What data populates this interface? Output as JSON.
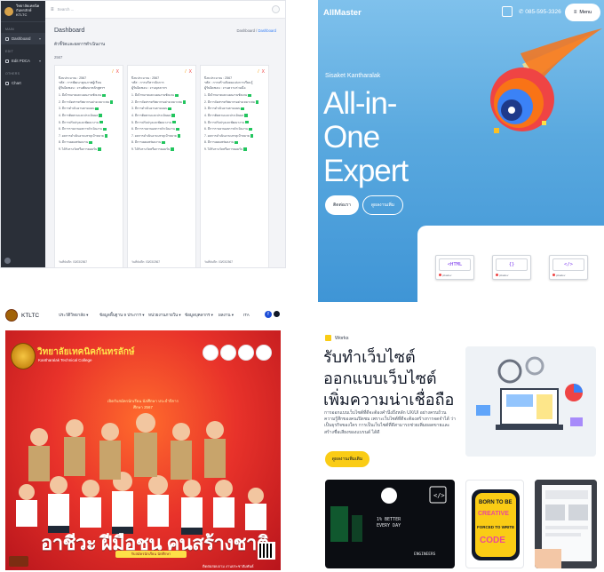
{
  "dashboard": {
    "brand_line1": "วิทยาลัยเทคนิคกันทรลักษ์",
    "brand_line2": "KTLTC",
    "search_placeholder": "Search ...",
    "nav_section_main": "MAIN",
    "nav_dashboard": "Dashboard",
    "nav_section_edit": "EDIT",
    "nav_edit_pdca": "Edit PDCA",
    "nav_section_other": "OTHERS",
    "nav_chart": "Chart",
    "page_title": "Dashboard",
    "breadcrumb_root": "Dashboard",
    "breadcrumb_sep": " / ",
    "breadcrumb_current": "Dashboard",
    "subtitle": "ตัวชี้วัดและผลการดำเนินงาน",
    "year": "2567",
    "cards": [
      {
        "meta_year": "ปีงบประมาณ : 2567",
        "meta_code": "รหัส : การพัฒนาคุณภาพผู้เรียน",
        "meta_owner": "ผู้รับผิดชอบ : งานพัฒนาหลักสูตรฯ",
        "items": [
          "1. มีเป้าหมายและแผนงานชัดเจน",
          "2. มีการจัดสรรทรัพยากรอย่างเหมาะสม",
          "3. มีการดำเนินงานตามแผน",
          "4. มีการติดตามและประเมินผล",
          "5. มีการปรับปรุงและพัฒนางาน",
          "6. มีการรายงานผลการดำเนินงาน",
          "7. ผลการดำเนินงานบรรลุเป้าหมาย",
          "8. มีการเผยแพร่ผลงาน",
          "9. ได้รับรางวัลหรือการยอมรับ"
        ],
        "footer": "วันที่บันทึก: 03/03/2567"
      },
      {
        "meta_year": "ปีงบประมาณ : 2567",
        "meta_code": "รหัส : การบริหารจัดการ",
        "meta_owner": "ผู้รับผิดชอบ : งานบุคลากร",
        "items": [
          "1. มีเป้าหมายและแผนงานชัดเจน",
          "2. มีการจัดสรรทรัพยากรอย่างเหมาะสม",
          "3. มีการดำเนินงานตามแผน",
          "4. มีการติดตามและประเมินผล",
          "5. มีการปรับปรุงและพัฒนางาน",
          "6. มีการรายงานผลการดำเนินงาน",
          "7. ผลการดำเนินงานบรรลุเป้าหมาย",
          "8. มีการเผยแพร่ผลงาน",
          "9. ได้รับรางวัลหรือการยอมรับ"
        ],
        "footer": "วันที่บันทึก: 03/03/2567"
      },
      {
        "meta_year": "ปีงบประมาณ : 2567",
        "meta_code": "รหัส : การสร้างสังคมแห่งการเรียนรู้",
        "meta_owner": "ผู้รับผิดชอบ : งานความร่วมมือ",
        "items": [
          "1. มีเป้าหมายและแผนงานชัดเจน",
          "2. มีการจัดสรรทรัพยากรอย่างเหมาะสม",
          "3. มีการดำเนินงานตามแผน",
          "4. มีการติดตามและประเมินผล",
          "5. มีการปรับปรุงและพัฒนางาน",
          "6. มีการรายงานผลการดำเนินงาน",
          "7. ผลการดำเนินงานบรรลุเป้าหมาย",
          "8. มีการเผยแพร่ผลงาน",
          "9. ได้รับรางวัลหรือการยอมรับ"
        ],
        "footer": "วันที่บันทึก: 03/03/2567"
      }
    ],
    "edit_icon_glyph": "/",
    "delete_icon_glyph": "X"
  },
  "allmaster": {
    "logo": "AllMaster",
    "phone": "085-595-3326",
    "menu_label": "Menu",
    "school": "Sisaket Kantharalak",
    "headline_1": "All-in-",
    "headline_2": "One",
    "headline_3": "Expert",
    "btn_primary": "ติดต่อเรา",
    "btn_secondary": "ดูผลงานเพิ่ม",
    "chips": [
      {
        "code": "<HTML",
        "caption": "pikadev"
      },
      {
        "code": "{}",
        "caption": "pikadev"
      },
      {
        "code": "</>",
        "caption": "pikadev"
      }
    ],
    "works_label": "Works",
    "works_title": "รับทำเว็บไซต์ ออกแบบเว็บไซต์ เพิ่มความน่าเชื่อถือ",
    "works_desc": "การออกแบบเว็บไซต์ที่ดีจะต้องคำนึงถึงหลัก UX/UI อย่างครบถ้วน ความรู้สึกของคนเปิดชม เพราะเว็บไซต์ที่ดีจะต้องสร้างการจดจำได้ ว่าเป็นธุรกิจของใคร การเป็นเว็บไซต์ที่ดีสามารถช่วยเพิ่มยอดขายและสร้างชื่อเสียงของแบรนด์ ได้ดี",
    "works_btn": "ดูผลงานเพิ่มเติม",
    "g1_text1": "1% BETTER",
    "g1_text2": "EVERY DAY",
    "g1_text3": "ENGINEERS",
    "g2_text1": "BORN TO BE",
    "g2_text2": "CREATIVE",
    "g2_text3": "FORCED TO WRITE",
    "g2_text4": "CODE",
    "colors": {
      "hero_top": "#7fc1ec",
      "accent_yellow": "#facc15"
    }
  },
  "ktltc": {
    "brand": "KTLTC",
    "menu": [
      "ประวัติวิทยาลัย",
      "ข้อมูลพื้นฐาน 9 ประการ",
      "หน่วยงานภายใน",
      "ข้อมูลบุคลากร",
      "ผลงาน",
      "ITA"
    ],
    "school_name_th": "วิทยาลัยเทคนิคกันทรลักษ์",
    "school_name_en": "Kantharalak Technical College",
    "slogan_top": "เปิดรับสมัครนักเรียน นักศึกษา ประจำปีการศึกษา 2567",
    "slogan_main": "อาชีวะ ฝีมือชน คนสร้างชาติ",
    "cta": "รับสมัครนักเรียน นักศึกษา",
    "info": "ติดต่อสอบถาม งานประชาสัมพันธ์"
  }
}
